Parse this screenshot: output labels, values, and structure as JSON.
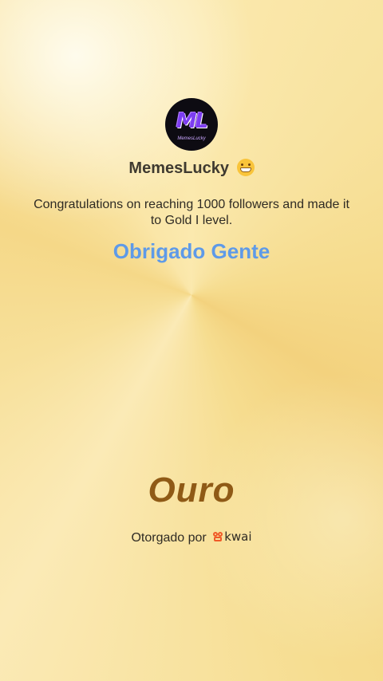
{
  "profile": {
    "avatar_monogram": "ML",
    "avatar_caption": "MemesLucky",
    "username": "MemesLucky",
    "emoji_icon": "grinning-face-icon"
  },
  "message": {
    "congrats_text": "Congratulations on reaching 1000 followers and made it to Gold I level.",
    "thanks_text": "Obrigado Gente"
  },
  "award": {
    "level_name": "Ouro",
    "awarded_by_label": "Otorgado por",
    "brand_name": "kwai",
    "brand_icon": "kwai-logo-icon"
  },
  "colors": {
    "background_gold": "#f6dc8e",
    "thanks_blue": "#5e9ae8",
    "level_brown": "#8f5a16",
    "kwai_orange": "#f05a28"
  }
}
